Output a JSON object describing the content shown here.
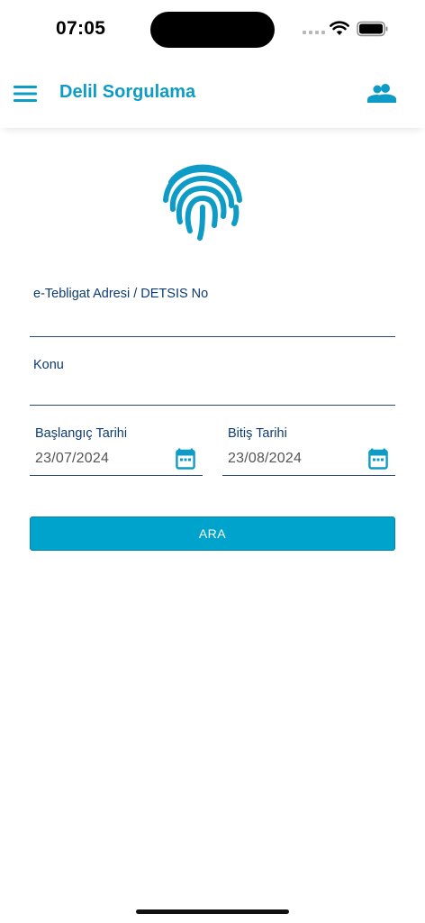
{
  "status_bar": {
    "time": "07:05"
  },
  "header": {
    "title": "Delil Sorgulama",
    "menu_icon": "hamburger-menu-icon",
    "users_icon": "people-icon"
  },
  "logo": {
    "icon": "fingerprint-icon",
    "color": "#0e9cc6"
  },
  "form": {
    "address_field": {
      "label": "e-Tebligat Adresi / DETSIS No",
      "value": ""
    },
    "subject_field": {
      "label": "Konu",
      "value": ""
    },
    "start_date": {
      "label": "Başlangıç Tarihi",
      "value": "23/07/2024",
      "icon": "calendar-icon"
    },
    "end_date": {
      "label": "Bitiş Tarihi",
      "value": "23/08/2024",
      "icon": "calendar-icon"
    },
    "search_button": {
      "label": "ARA"
    }
  },
  "colors": {
    "accent": "#0e9cc6",
    "button": "#00a3cc",
    "label": "#0b3b70"
  }
}
